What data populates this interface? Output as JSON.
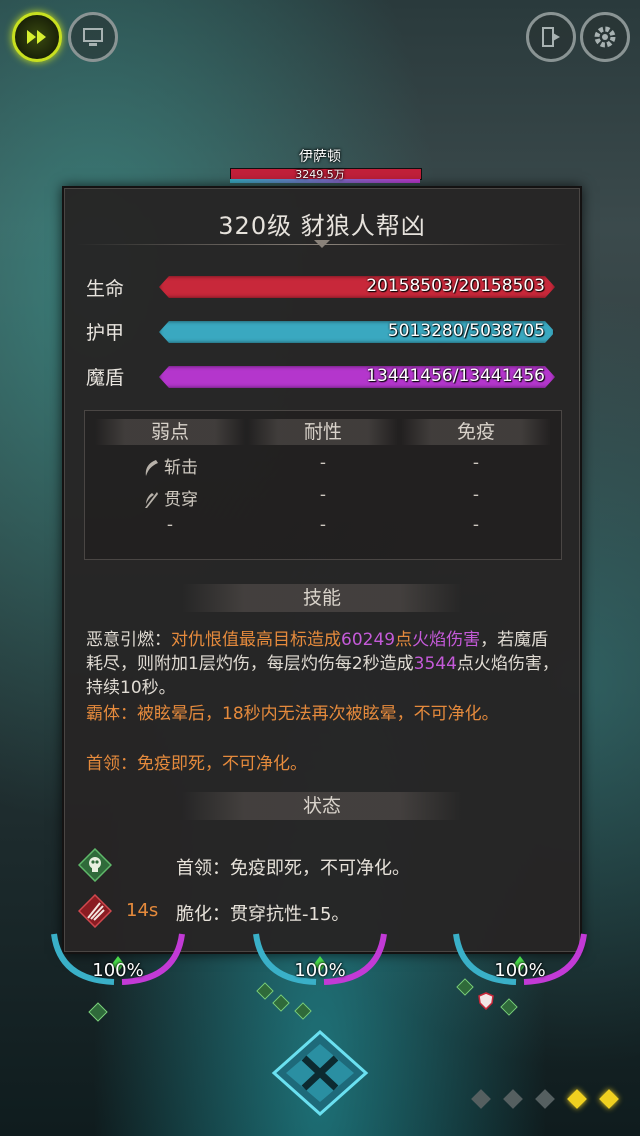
{
  "boss": {
    "name": "伊萨顿",
    "hp": "3249.5万"
  },
  "panel": {
    "title": "320级  豺狼人帮凶",
    "stats": [
      {
        "label": "生命",
        "value": "20158503/20158503",
        "color": "#c8283a",
        "fill": 1.0
      },
      {
        "label": "护甲",
        "value": "5013280/5038705",
        "color": "#3aa8c0",
        "fill": 0.995
      },
      {
        "label": "魔盾",
        "value": "13441456/13441456",
        "color": "#b436cc",
        "fill": 1.0
      }
    ],
    "resist": {
      "headers": [
        "弱点",
        "耐性",
        "免疫"
      ],
      "rows": [
        [
          "斩击",
          "-",
          "-"
        ],
        [
          "贯穿",
          "-",
          "-"
        ],
        [
          "-",
          "-",
          "-"
        ]
      ]
    },
    "skill_header": "技能",
    "skill": {
      "p1_a": "恶意引燃：",
      "p1_b": "对仇恨值最高目标造成",
      "p1_c": "60249",
      "p1_d": "点",
      "p1_e": "火焰伤害",
      "p1_f": "，若魔盾耗尽，则附加1层灼伤，每层灼伤每2秒造成",
      "p1_g": "3544",
      "p1_h": "点火焰伤害，持续10秒。",
      "p2": "霸体：被眩晕后，18秒内无法再次被眩晕，不可净化。",
      "p3": "首领：免疫即死，不可净化。"
    },
    "status_header": "状态",
    "status": [
      {
        "time": "",
        "text": "首领：免疫即死，不可净化。",
        "icon": "skull-icon"
      },
      {
        "time": "14s",
        "text": "脆化：贯穿抗性-15。",
        "icon": "claw-icon"
      }
    ]
  },
  "units": [
    {
      "pct": "100%"
    },
    {
      "pct": "100%"
    },
    {
      "pct": "100%"
    }
  ],
  "colors": {
    "accent": "#e58a3c",
    "purple": "#c45ad8",
    "hp": "#c8283a",
    "armor": "#3aa8c0",
    "shield": "#b436cc"
  }
}
